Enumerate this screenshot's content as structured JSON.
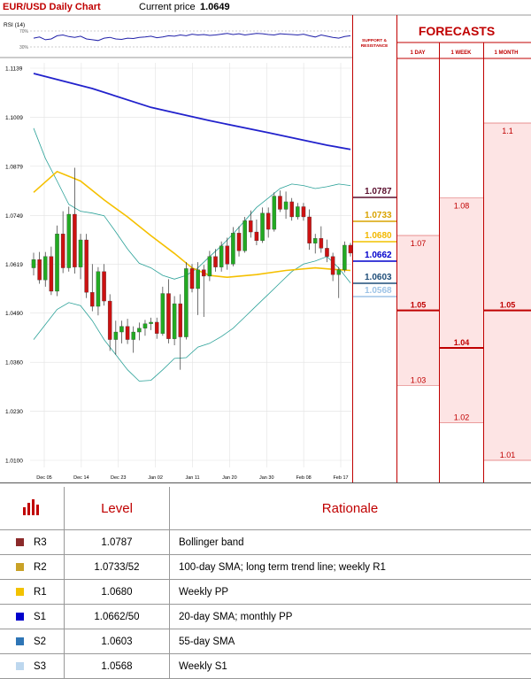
{
  "header": {
    "title": "EUR/USD Daily Chart",
    "current_price_label": "Current price",
    "current_price": "1.0649"
  },
  "rsi": {
    "label": "RSI (14)",
    "upper_level": "70%",
    "lower_level": "30%"
  },
  "side": {
    "sr_label_line1": "SUPPORT &",
    "sr_label_line2": "RESISTANCE",
    "forecasts_title": "FORECASTS",
    "col_day": "1 DAY",
    "col_week": "1 WEEK",
    "col_month": "1 MONTH"
  },
  "chart_data": {
    "type": "candlestick",
    "title": "EUR/USD Daily Chart",
    "ylim": [
      1.01,
      1.1139
    ],
    "y_ticks": [
      "1.1139",
      "1.1009",
      "1.0879",
      "1.0749",
      "1.0619",
      "1.0490",
      "1.0360",
      "1.0230",
      "1.0100"
    ],
    "x_ticks": [
      "Dec 05",
      "Dec 14",
      "Dec 23",
      "Jan 02",
      "Jan 11",
      "Jan 20",
      "Jan 30",
      "Feb 08",
      "Feb 17"
    ],
    "candles": [
      {
        "o": 1.061,
        "h": 1.065,
        "l": 1.059,
        "c": 1.0632
      },
      {
        "o": 1.0632,
        "h": 1.0652,
        "l": 1.0568,
        "c": 1.0578
      },
      {
        "o": 1.0578,
        "h": 1.0652,
        "l": 1.056,
        "c": 1.064
      },
      {
        "o": 1.064,
        "h": 1.0666,
        "l": 1.0538,
        "c": 1.0548
      },
      {
        "o": 1.0548,
        "h": 1.0722,
        "l": 1.0535,
        "c": 1.07
      },
      {
        "o": 1.07,
        "h": 1.076,
        "l": 1.0596,
        "c": 1.061
      },
      {
        "o": 1.061,
        "h": 1.0772,
        "l": 1.06,
        "c": 1.0752
      },
      {
        "o": 1.0752,
        "h": 1.0875,
        "l": 1.0595,
        "c": 1.0612
      },
      {
        "o": 1.0612,
        "h": 1.07,
        "l": 1.058,
        "c": 1.0684
      },
      {
        "o": 1.0684,
        "h": 1.07,
        "l": 1.053,
        "c": 1.0545
      },
      {
        "o": 1.0545,
        "h": 1.062,
        "l": 1.0495,
        "c": 1.0508
      },
      {
        "o": 1.0508,
        "h": 1.0612,
        "l": 1.0484,
        "c": 1.06
      },
      {
        "o": 1.06,
        "h": 1.062,
        "l": 1.051,
        "c": 1.0522
      },
      {
        "o": 1.0522,
        "h": 1.054,
        "l": 1.039,
        "c": 1.042
      },
      {
        "o": 1.042,
        "h": 1.047,
        "l": 1.038,
        "c": 1.044
      },
      {
        "o": 1.044,
        "h": 1.047,
        "l": 1.041,
        "c": 1.0455
      },
      {
        "o": 1.0455,
        "h": 1.0475,
        "l": 1.0408,
        "c": 1.042
      },
      {
        "o": 1.042,
        "h": 1.0455,
        "l": 1.0385,
        "c": 1.044
      },
      {
        "o": 1.044,
        "h": 1.0465,
        "l": 1.0418,
        "c": 1.045
      },
      {
        "o": 1.045,
        "h": 1.0472,
        "l": 1.043,
        "c": 1.0462
      },
      {
        "o": 1.0462,
        "h": 1.0478,
        "l": 1.0445,
        "c": 1.0466
      },
      {
        "o": 1.0466,
        "h": 1.0478,
        "l": 1.0422,
        "c": 1.0436
      },
      {
        "o": 1.0436,
        "h": 1.056,
        "l": 1.043,
        "c": 1.0542
      },
      {
        "o": 1.0542,
        "h": 1.058,
        "l": 1.041,
        "c": 1.0422
      },
      {
        "o": 1.0422,
        "h": 1.0535,
        "l": 1.0405,
        "c": 1.0515
      },
      {
        "o": 1.0515,
        "h": 1.054,
        "l": 1.034,
        "c": 1.0427
      },
      {
        "o": 1.0427,
        "h": 1.0625,
        "l": 1.042,
        "c": 1.0608
      },
      {
        "o": 1.0608,
        "h": 1.062,
        "l": 1.0545,
        "c": 1.0555
      },
      {
        "o": 1.0555,
        "h": 1.0625,
        "l": 1.0485,
        "c": 1.0605
      },
      {
        "o": 1.0605,
        "h": 1.0618,
        "l": 1.048,
        "c": 1.0588
      },
      {
        "o": 1.0588,
        "h": 1.0655,
        "l": 1.0575,
        "c": 1.064
      },
      {
        "o": 1.064,
        "h": 1.066,
        "l": 1.06,
        "c": 1.0612
      },
      {
        "o": 1.0612,
        "h": 1.068,
        "l": 1.06,
        "c": 1.0668
      },
      {
        "o": 1.0668,
        "h": 1.069,
        "l": 1.0605,
        "c": 1.062
      },
      {
        "o": 1.062,
        "h": 1.0718,
        "l": 1.0614,
        "c": 1.0702
      },
      {
        "o": 1.0702,
        "h": 1.072,
        "l": 1.064,
        "c": 1.0655
      },
      {
        "o": 1.0655,
        "h": 1.0745,
        "l": 1.065,
        "c": 1.0735
      },
      {
        "o": 1.0735,
        "h": 1.0762,
        "l": 1.069,
        "c": 1.0705
      },
      {
        "o": 1.0705,
        "h": 1.0738,
        "l": 1.067,
        "c": 1.0682
      },
      {
        "o": 1.0682,
        "h": 1.077,
        "l": 1.0676,
        "c": 1.0755
      },
      {
        "o": 1.0755,
        "h": 1.077,
        "l": 1.069,
        "c": 1.0712
      },
      {
        "o": 1.0712,
        "h": 1.081,
        "l": 1.0706,
        "c": 1.08
      },
      {
        "o": 1.08,
        "h": 1.0815,
        "l": 1.0758,
        "c": 1.0765
      },
      {
        "o": 1.0765,
        "h": 1.0812,
        "l": 1.074,
        "c": 1.0785
      },
      {
        "o": 1.0785,
        "h": 1.0795,
        "l": 1.0735,
        "c": 1.0745
      },
      {
        "o": 1.0745,
        "h": 1.0782,
        "l": 1.0738,
        "c": 1.0772
      },
      {
        "o": 1.0772,
        "h": 1.0782,
        "l": 1.0735,
        "c": 1.0745
      },
      {
        "o": 1.0745,
        "h": 1.0765,
        "l": 1.0658,
        "c": 1.0675
      },
      {
        "o": 1.0675,
        "h": 1.07,
        "l": 1.0648,
        "c": 1.0688
      },
      {
        "o": 1.0688,
        "h": 1.072,
        "l": 1.065,
        "c": 1.0662
      },
      {
        "o": 1.0662,
        "h": 1.0685,
        "l": 1.0625,
        "c": 1.064
      },
      {
        "o": 1.064,
        "h": 1.065,
        "l": 1.0575,
        "c": 1.0592
      },
      {
        "o": 1.0592,
        "h": 1.0612,
        "l": 1.053,
        "c": 1.0605
      },
      {
        "o": 1.0605,
        "h": 1.068,
        "l": 1.0598,
        "c": 1.067
      },
      {
        "o": 1.067,
        "h": 1.0676,
        "l": 1.064,
        "c": 1.0649
      }
    ],
    "sma_long": [
      [
        0,
        1.1125
      ],
      [
        10,
        1.1085
      ],
      [
        20,
        1.1035
      ],
      [
        30,
        1.1
      ],
      [
        40,
        1.0968
      ],
      [
        50,
        1.0935
      ],
      [
        54,
        1.0924
      ]
    ],
    "sma_mid": [
      [
        0,
        1.081
      ],
      [
        4,
        1.0865
      ],
      [
        8,
        1.084
      ],
      [
        12,
        1.079
      ],
      [
        16,
        1.0745
      ],
      [
        20,
        1.0695
      ],
      [
        24,
        1.0648
      ],
      [
        27,
        1.061
      ],
      [
        30,
        1.059
      ],
      [
        33,
        1.0585
      ],
      [
        38,
        1.0592
      ],
      [
        43,
        1.0603
      ],
      [
        48,
        1.061
      ],
      [
        52,
        1.0605
      ],
      [
        54,
        1.0603
      ]
    ],
    "bb_upper": [
      [
        0,
        1.098
      ],
      [
        2,
        1.09
      ],
      [
        4,
        1.084
      ],
      [
        6,
        1.0778
      ],
      [
        8,
        1.076
      ],
      [
        10,
        1.0755
      ],
      [
        12,
        1.0748
      ],
      [
        14,
        1.0705
      ],
      [
        16,
        1.066
      ],
      [
        18,
        1.0622
      ],
      [
        20,
        1.061
      ],
      [
        22,
        1.059
      ],
      [
        24,
        1.058
      ],
      [
        26,
        1.059
      ],
      [
        28,
        1.061
      ],
      [
        30,
        1.064
      ],
      [
        32,
        1.0668
      ],
      [
        34,
        1.07
      ],
      [
        36,
        1.0735
      ],
      [
        38,
        1.077
      ],
      [
        40,
        1.0795
      ],
      [
        42,
        1.082
      ],
      [
        44,
        1.0832
      ],
      [
        46,
        1.0828
      ],
      [
        48,
        1.082
      ],
      [
        50,
        1.0825
      ],
      [
        52,
        1.0832
      ],
      [
        54,
        1.0828
      ]
    ],
    "bb_lower": [
      [
        0,
        1.042
      ],
      [
        2,
        1.046
      ],
      [
        4,
        1.05
      ],
      [
        6,
        1.0518
      ],
      [
        8,
        1.051
      ],
      [
        10,
        1.047
      ],
      [
        12,
        1.042
      ],
      [
        14,
        1.038
      ],
      [
        16,
        1.034
      ],
      [
        18,
        1.031
      ],
      [
        20,
        1.0312
      ],
      [
        22,
        1.034
      ],
      [
        24,
        1.037
      ],
      [
        26,
        1.0372
      ],
      [
        28,
        1.04
      ],
      [
        30,
        1.041
      ],
      [
        32,
        1.0428
      ],
      [
        34,
        1.045
      ],
      [
        36,
        1.048
      ],
      [
        38,
        1.051
      ],
      [
        40,
        1.054
      ],
      [
        42,
        1.057
      ],
      [
        44,
        1.06
      ],
      [
        46,
        1.062
      ],
      [
        48,
        1.0628
      ],
      [
        50,
        1.064
      ],
      [
        52,
        1.061
      ],
      [
        54,
        1.057
      ]
    ],
    "sr_markers": [
      {
        "id": "R3",
        "label": "1.0787",
        "value": 1.0787,
        "line_color": "#5a0f2e",
        "text_color": "#5a0f2e"
      },
      {
        "id": "R2",
        "label": "1.0733",
        "value": 1.0733,
        "line_color": "#d9a300",
        "text_color": "#d9a300"
      },
      {
        "id": "R1",
        "label": "1.0680",
        "value": 1.068,
        "line_color": "#f2c200",
        "text_color": "#f2b800"
      },
      {
        "id": "S1",
        "label": "1.0662",
        "value": 1.0662,
        "line_color": "#0000cc",
        "text_color": "#0000cc"
      },
      {
        "id": "S2",
        "label": "1.0603",
        "value": 1.0603,
        "line_color": "#1f4e79",
        "text_color": "#1f4e79"
      },
      {
        "id": "S3",
        "label": "1.0568",
        "value": 1.0568,
        "line_color": "#9dc3e6",
        "text_color": "#9dc3e6"
      }
    ],
    "forecasts": [
      {
        "horizon": "1 DAY",
        "high": 1.07,
        "central": 1.05,
        "low": 1.03,
        "high_label": "1.07",
        "central_label": "1.05",
        "low_label": "1.03"
      },
      {
        "horizon": "1 WEEK",
        "high": 1.08,
        "central": 1.04,
        "low": 1.02,
        "high_label": "1.08",
        "central_label": "1.04",
        "low_label": "1.02"
      },
      {
        "horizon": "1 MONTH",
        "high": 1.1,
        "central": 1.05,
        "low": 1.01,
        "high_label": "1.1",
        "central_label": "1.05",
        "low_label": "1.01"
      }
    ],
    "rsi_series": [
      52,
      55,
      48,
      50,
      58,
      60,
      56,
      54,
      57,
      50,
      48,
      46,
      52,
      54,
      50,
      49,
      52,
      51,
      54,
      55,
      57,
      53,
      55,
      58,
      57,
      60,
      58,
      62,
      60,
      61,
      59,
      60,
      62,
      64,
      61,
      63,
      60,
      62,
      64,
      63,
      61,
      60,
      63,
      62,
      61,
      60,
      62,
      58,
      55,
      60,
      57,
      54,
      52,
      56,
      58
    ]
  },
  "table": {
    "headers": {
      "level": "Level",
      "rationale": "Rationale"
    },
    "rows": [
      {
        "id": "R3",
        "level": "1.0787",
        "rationale": "Bollinger band",
        "color": "#8b2a2a"
      },
      {
        "id": "R2",
        "level": "1.0733/52",
        "rationale": "100-day SMA; long term trend line; weekly R1",
        "color": "#c9a227"
      },
      {
        "id": "R1",
        "level": "1.0680",
        "rationale": "Weekly PP",
        "color": "#f2c200"
      },
      {
        "id": "S1",
        "level": "1.0662/50",
        "rationale": "20-day SMA; monthly PP",
        "color": "#0000cc"
      },
      {
        "id": "S2",
        "level": "1.0603",
        "rationale": "55-day SMA",
        "color": "#2e75b6"
      },
      {
        "id": "S3",
        "level": "1.0568",
        "rationale": "Weekly S1",
        "color": "#bdd7ee"
      }
    ]
  },
  "colors": {
    "accent": "#c00000",
    "sma_long": "#2222cc",
    "sma_mid": "#f5c000",
    "bollinger": "#2aa198",
    "bull": "#22aa22",
    "bear": "#cc1111",
    "forecast_fill": "#fde4e4"
  }
}
